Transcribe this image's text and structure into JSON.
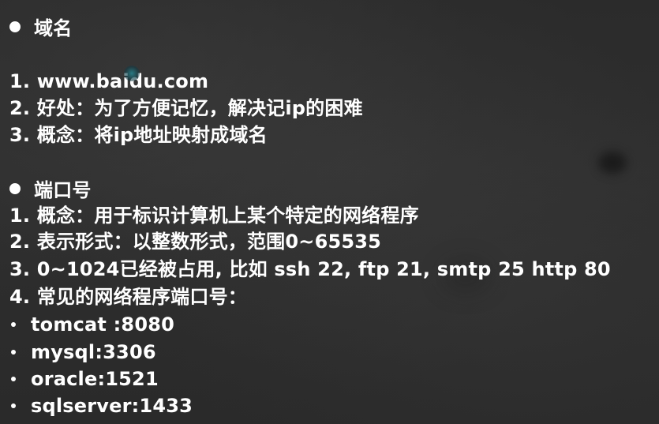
{
  "section_domain": {
    "heading": "域名",
    "items": [
      "1. www.baidu.com",
      "2. 好处：为了方便记忆，解决记ip的困难",
      "3. 概念：将ip地址映射成域名"
    ]
  },
  "section_port": {
    "heading": "端口号",
    "items": [
      "1. 概念：用于标识计算机上某个特定的网络程序",
      "2. 表示形式：以整数形式，范围0~65535",
      "3. 0~1024已经被占用, 比如 ssh 22, ftp 21, smtp 25  http 80",
      "4. 常见的网络程序端口号："
    ],
    "ports": [
      "tomcat :8080",
      "mysql:3306",
      "oracle:1521",
      "sqlserver:1433"
    ]
  }
}
